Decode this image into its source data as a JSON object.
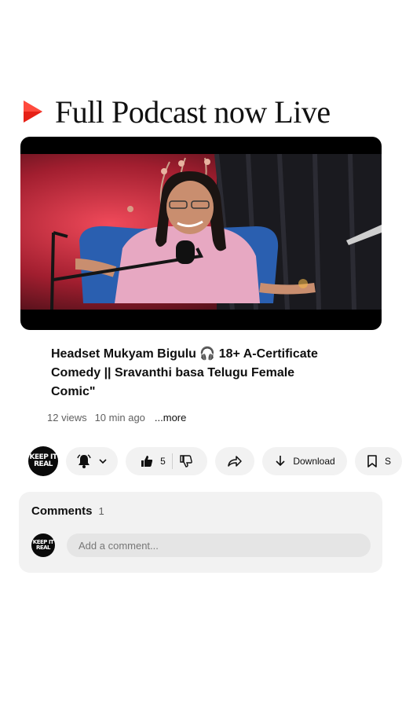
{
  "promo": {
    "text": "Full Podcast now Live"
  },
  "video": {
    "title": "Headset Mukyam Bigulu 🎧 18+ A-Certificate Comedy || Sravanthi basa Telugu Female Comic\"",
    "views": "12 views",
    "age": "10 min ago",
    "more": "...more"
  },
  "channel": {
    "avatar_text": "KEEP IT REAL"
  },
  "actions": {
    "like_count": "5",
    "download_label": "Download",
    "save_label": "S"
  },
  "comments": {
    "heading": "Comments",
    "count": "1",
    "placeholder": "Add a comment..."
  },
  "colors": {
    "accent_red": "#e62117",
    "pill_bg": "#f2f2f2"
  }
}
